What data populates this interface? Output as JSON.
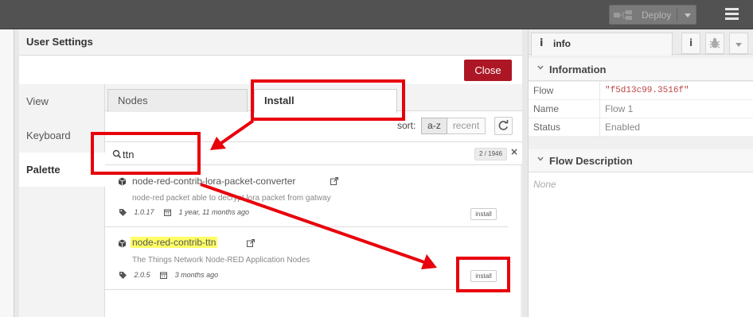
{
  "header": {
    "deploy_label": "Deploy",
    "deploy_icon": "deploy-flow-icon",
    "menu_icon": "hamburger-menu-icon"
  },
  "dialog": {
    "title": "User Settings",
    "close_label": "Close",
    "close_color": "#ad1625",
    "side_tabs": [
      {
        "label": "View",
        "active": false
      },
      {
        "label": "Keyboard",
        "active": false
      },
      {
        "label": "Palette",
        "active": true
      }
    ],
    "tabs": [
      {
        "label": "Nodes",
        "active": false
      },
      {
        "label": "Install",
        "active": true
      }
    ],
    "sort": {
      "label": "sort:",
      "options": [
        "a-z",
        "recent"
      ],
      "selected": "a-z",
      "refresh_icon": "refresh-icon"
    },
    "search": {
      "value": "ttn",
      "icon": "search-icon",
      "result_count": "2 / 1946",
      "clear_glyph": "×"
    },
    "results": [
      {
        "name": "node-red-contrib-lora-packet-converter",
        "highlighted": false,
        "description": "node-red packet able to decrypt lora packet from gatway",
        "version": "1.0.17",
        "updated": "1 year, 11 months ago",
        "install_label": "install"
      },
      {
        "name": "node-red-contrib-ttn",
        "highlighted": true,
        "description": "The Things Network Node-RED Application Nodes",
        "version": "2.0.5",
        "updated": "3 months ago",
        "install_label": "install"
      }
    ]
  },
  "sidebar": {
    "tab_label": "info",
    "tab_glyph": "i",
    "info_button_glyph": "i",
    "debug_icon": "bug-icon",
    "sections": {
      "information": "Information",
      "flow_description": "Flow Description"
    },
    "properties": [
      {
        "key": "Flow",
        "value": "\"f5d13c99.3516f\""
      },
      {
        "key": "Name",
        "value": "Flow 1"
      },
      {
        "key": "Status",
        "value": "Enabled"
      }
    ],
    "description_placeholder": "None"
  },
  "annotations": {
    "highlight_color": "#e8000b"
  }
}
